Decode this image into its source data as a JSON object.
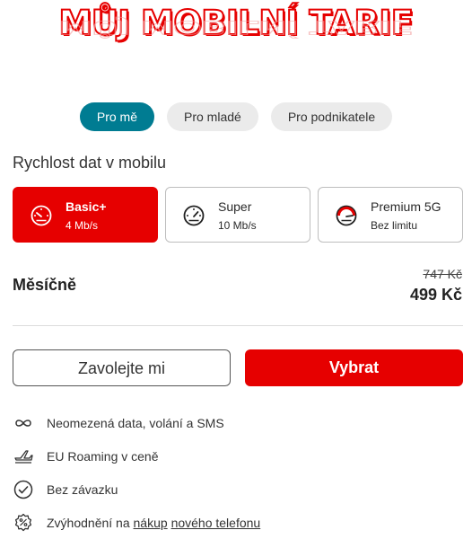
{
  "header": {
    "title": "MŮJ MOBILNÍ TARIF"
  },
  "tabs": [
    {
      "label": "Pro mě",
      "active": true
    },
    {
      "label": "Pro mladé",
      "active": false
    },
    {
      "label": "Pro podnikatele",
      "active": false
    }
  ],
  "speed_section": {
    "label": "Rychlost dat v mobilu",
    "options": [
      {
        "name": "Basic+",
        "speed": "4 Mb/s",
        "icon": "speedometer-low-icon",
        "selected": true
      },
      {
        "name": "Super",
        "speed": "10 Mb/s",
        "icon": "speedometer-mid-icon",
        "selected": false
      },
      {
        "name": "Premium 5G",
        "speed": "Bez limitu",
        "icon": "speedometer-high-icon",
        "selected": false
      }
    ]
  },
  "price": {
    "label": "Měsíčně",
    "old": "747 Kč",
    "current": "499 Kč"
  },
  "actions": {
    "call": "Zavolejte mi",
    "select": "Vybrat"
  },
  "features": {
    "unlimited": "Neomezená data, volání a SMS",
    "roaming": "EU Roaming v ceně",
    "no_commitment": "Bez závazku",
    "discount_prefix": "Zvýhodnění na ",
    "discount_link_1": "nákup",
    "discount_link_2": "nového telefonu"
  },
  "colors": {
    "accent": "#e60000",
    "tab_active": "#007c92",
    "tab_inactive": "#ebebeb"
  }
}
